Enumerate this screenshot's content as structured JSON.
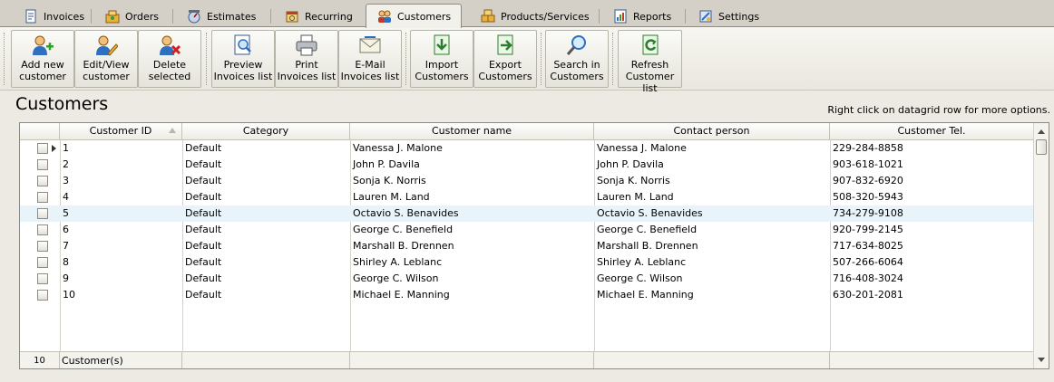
{
  "tabs": [
    {
      "label": "Invoices",
      "icon": "invoice-icon"
    },
    {
      "label": "Orders",
      "icon": "orders-icon"
    },
    {
      "label": "Estimates",
      "icon": "estimates-icon"
    },
    {
      "label": "Recurring",
      "icon": "recurring-icon"
    },
    {
      "label": "Customers",
      "icon": "customers-icon",
      "active": true
    },
    {
      "label": "Products/Services",
      "icon": "products-icon"
    },
    {
      "label": "Reports",
      "icon": "reports-icon"
    },
    {
      "label": "Settings",
      "icon": "settings-icon"
    }
  ],
  "toolbar": {
    "buttons": [
      {
        "label": "Add new\ncustomer",
        "icon": "add-user-icon"
      },
      {
        "label": "Edit/View\ncustomer",
        "icon": "edit-user-icon"
      },
      {
        "label": "Delete\nselected",
        "icon": "delete-user-icon"
      },
      {
        "label": "Preview\nInvoices list",
        "icon": "preview-icon"
      },
      {
        "label": "Print\nInvoices list",
        "icon": "printer-icon"
      },
      {
        "label": "E-Mail\nInvoices list",
        "icon": "email-icon"
      },
      {
        "label": "Import\nCustomers",
        "icon": "import-icon"
      },
      {
        "label": "Export\nCustomers",
        "icon": "export-icon"
      },
      {
        "label": "Search in\nCustomers",
        "icon": "search-icon"
      },
      {
        "label": "Refresh\nCustomer list",
        "icon": "refresh-icon"
      }
    ]
  },
  "page": {
    "title": "Customers",
    "hint": "Right click on datagrid row for more options."
  },
  "grid": {
    "columns": [
      "Customer ID",
      "Category",
      "Customer name",
      "Contact person",
      "Customer Tel."
    ],
    "rows": [
      {
        "id": "1",
        "category": "Default",
        "name": "Vanessa J. Malone",
        "contact": "Vanessa J. Malone",
        "tel": "229-284-8858"
      },
      {
        "id": "2",
        "category": "Default",
        "name": "John P. Davila",
        "contact": "John P. Davila",
        "tel": "903-618-1021"
      },
      {
        "id": "3",
        "category": "Default",
        "name": "Sonja K. Norris",
        "contact": "Sonja K. Norris",
        "tel": "907-832-6920"
      },
      {
        "id": "4",
        "category": "Default",
        "name": "Lauren M. Land",
        "contact": "Lauren M. Land",
        "tel": "508-320-5943"
      },
      {
        "id": "5",
        "category": "Default",
        "name": "Octavio S. Benavides",
        "contact": "Octavio S. Benavides",
        "tel": "734-279-9108"
      },
      {
        "id": "6",
        "category": "Default",
        "name": "George C. Benefield",
        "contact": "George C. Benefield",
        "tel": "920-799-2145"
      },
      {
        "id": "7",
        "category": "Default",
        "name": "Marshall B. Drennen",
        "contact": "Marshall B. Drennen",
        "tel": "717-634-8025"
      },
      {
        "id": "8",
        "category": "Default",
        "name": "Shirley A. Leblanc",
        "contact": "Shirley A. Leblanc",
        "tel": "507-266-6064"
      },
      {
        "id": "9",
        "category": "Default",
        "name": "George C. Wilson",
        "contact": "George C. Wilson",
        "tel": "716-408-3024"
      },
      {
        "id": "10",
        "category": "Default",
        "name": "Michael E. Manning",
        "contact": "Michael E. Manning",
        "tel": "630-201-2081"
      }
    ],
    "footer": {
      "count": "10",
      "label": "Customer(s)"
    }
  },
  "colors": {
    "selected_row": "#e8f3fa",
    "tab_bar": "#d4d0c8",
    "toolbar": "#f1f0ea"
  }
}
